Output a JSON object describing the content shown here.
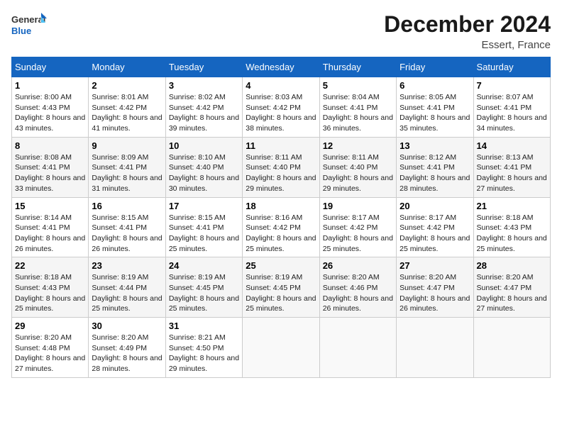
{
  "logo": {
    "general": "General",
    "blue": "Blue"
  },
  "title": "December 2024",
  "subtitle": "Essert, France",
  "days": [
    "Sunday",
    "Monday",
    "Tuesday",
    "Wednesday",
    "Thursday",
    "Friday",
    "Saturday"
  ],
  "weeks": [
    [
      {
        "day": "1",
        "sunrise": "8:00 AM",
        "sunset": "4:43 PM",
        "daylight": "8 hours and 43 minutes."
      },
      {
        "day": "2",
        "sunrise": "8:01 AM",
        "sunset": "4:42 PM",
        "daylight": "8 hours and 41 minutes."
      },
      {
        "day": "3",
        "sunrise": "8:02 AM",
        "sunset": "4:42 PM",
        "daylight": "8 hours and 39 minutes."
      },
      {
        "day": "4",
        "sunrise": "8:03 AM",
        "sunset": "4:42 PM",
        "daylight": "8 hours and 38 minutes."
      },
      {
        "day": "5",
        "sunrise": "8:04 AM",
        "sunset": "4:41 PM",
        "daylight": "8 hours and 36 minutes."
      },
      {
        "day": "6",
        "sunrise": "8:05 AM",
        "sunset": "4:41 PM",
        "daylight": "8 hours and 35 minutes."
      },
      {
        "day": "7",
        "sunrise": "8:07 AM",
        "sunset": "4:41 PM",
        "daylight": "8 hours and 34 minutes."
      }
    ],
    [
      {
        "day": "8",
        "sunrise": "8:08 AM",
        "sunset": "4:41 PM",
        "daylight": "8 hours and 33 minutes."
      },
      {
        "day": "9",
        "sunrise": "8:09 AM",
        "sunset": "4:41 PM",
        "daylight": "8 hours and 31 minutes."
      },
      {
        "day": "10",
        "sunrise": "8:10 AM",
        "sunset": "4:40 PM",
        "daylight": "8 hours and 30 minutes."
      },
      {
        "day": "11",
        "sunrise": "8:11 AM",
        "sunset": "4:40 PM",
        "daylight": "8 hours and 29 minutes."
      },
      {
        "day": "12",
        "sunrise": "8:11 AM",
        "sunset": "4:40 PM",
        "daylight": "8 hours and 29 minutes."
      },
      {
        "day": "13",
        "sunrise": "8:12 AM",
        "sunset": "4:41 PM",
        "daylight": "8 hours and 28 minutes."
      },
      {
        "day": "14",
        "sunrise": "8:13 AM",
        "sunset": "4:41 PM",
        "daylight": "8 hours and 27 minutes."
      }
    ],
    [
      {
        "day": "15",
        "sunrise": "8:14 AM",
        "sunset": "4:41 PM",
        "daylight": "8 hours and 26 minutes."
      },
      {
        "day": "16",
        "sunrise": "8:15 AM",
        "sunset": "4:41 PM",
        "daylight": "8 hours and 26 minutes."
      },
      {
        "day": "17",
        "sunrise": "8:15 AM",
        "sunset": "4:41 PM",
        "daylight": "8 hours and 25 minutes."
      },
      {
        "day": "18",
        "sunrise": "8:16 AM",
        "sunset": "4:42 PM",
        "daylight": "8 hours and 25 minutes."
      },
      {
        "day": "19",
        "sunrise": "8:17 AM",
        "sunset": "4:42 PM",
        "daylight": "8 hours and 25 minutes."
      },
      {
        "day": "20",
        "sunrise": "8:17 AM",
        "sunset": "4:42 PM",
        "daylight": "8 hours and 25 minutes."
      },
      {
        "day": "21",
        "sunrise": "8:18 AM",
        "sunset": "4:43 PM",
        "daylight": "8 hours and 25 minutes."
      }
    ],
    [
      {
        "day": "22",
        "sunrise": "8:18 AM",
        "sunset": "4:43 PM",
        "daylight": "8 hours and 25 minutes."
      },
      {
        "day": "23",
        "sunrise": "8:19 AM",
        "sunset": "4:44 PM",
        "daylight": "8 hours and 25 minutes."
      },
      {
        "day": "24",
        "sunrise": "8:19 AM",
        "sunset": "4:45 PM",
        "daylight": "8 hours and 25 minutes."
      },
      {
        "day": "25",
        "sunrise": "8:19 AM",
        "sunset": "4:45 PM",
        "daylight": "8 hours and 25 minutes."
      },
      {
        "day": "26",
        "sunrise": "8:20 AM",
        "sunset": "4:46 PM",
        "daylight": "8 hours and 26 minutes."
      },
      {
        "day": "27",
        "sunrise": "8:20 AM",
        "sunset": "4:47 PM",
        "daylight": "8 hours and 26 minutes."
      },
      {
        "day": "28",
        "sunrise": "8:20 AM",
        "sunset": "4:47 PM",
        "daylight": "8 hours and 27 minutes."
      }
    ],
    [
      {
        "day": "29",
        "sunrise": "8:20 AM",
        "sunset": "4:48 PM",
        "daylight": "8 hours and 27 minutes."
      },
      {
        "day": "30",
        "sunrise": "8:20 AM",
        "sunset": "4:49 PM",
        "daylight": "8 hours and 28 minutes."
      },
      {
        "day": "31",
        "sunrise": "8:21 AM",
        "sunset": "4:50 PM",
        "daylight": "8 hours and 29 minutes."
      },
      null,
      null,
      null,
      null
    ]
  ],
  "labels": {
    "sunrise": "Sunrise:",
    "sunset": "Sunset:",
    "daylight": "Daylight:"
  }
}
